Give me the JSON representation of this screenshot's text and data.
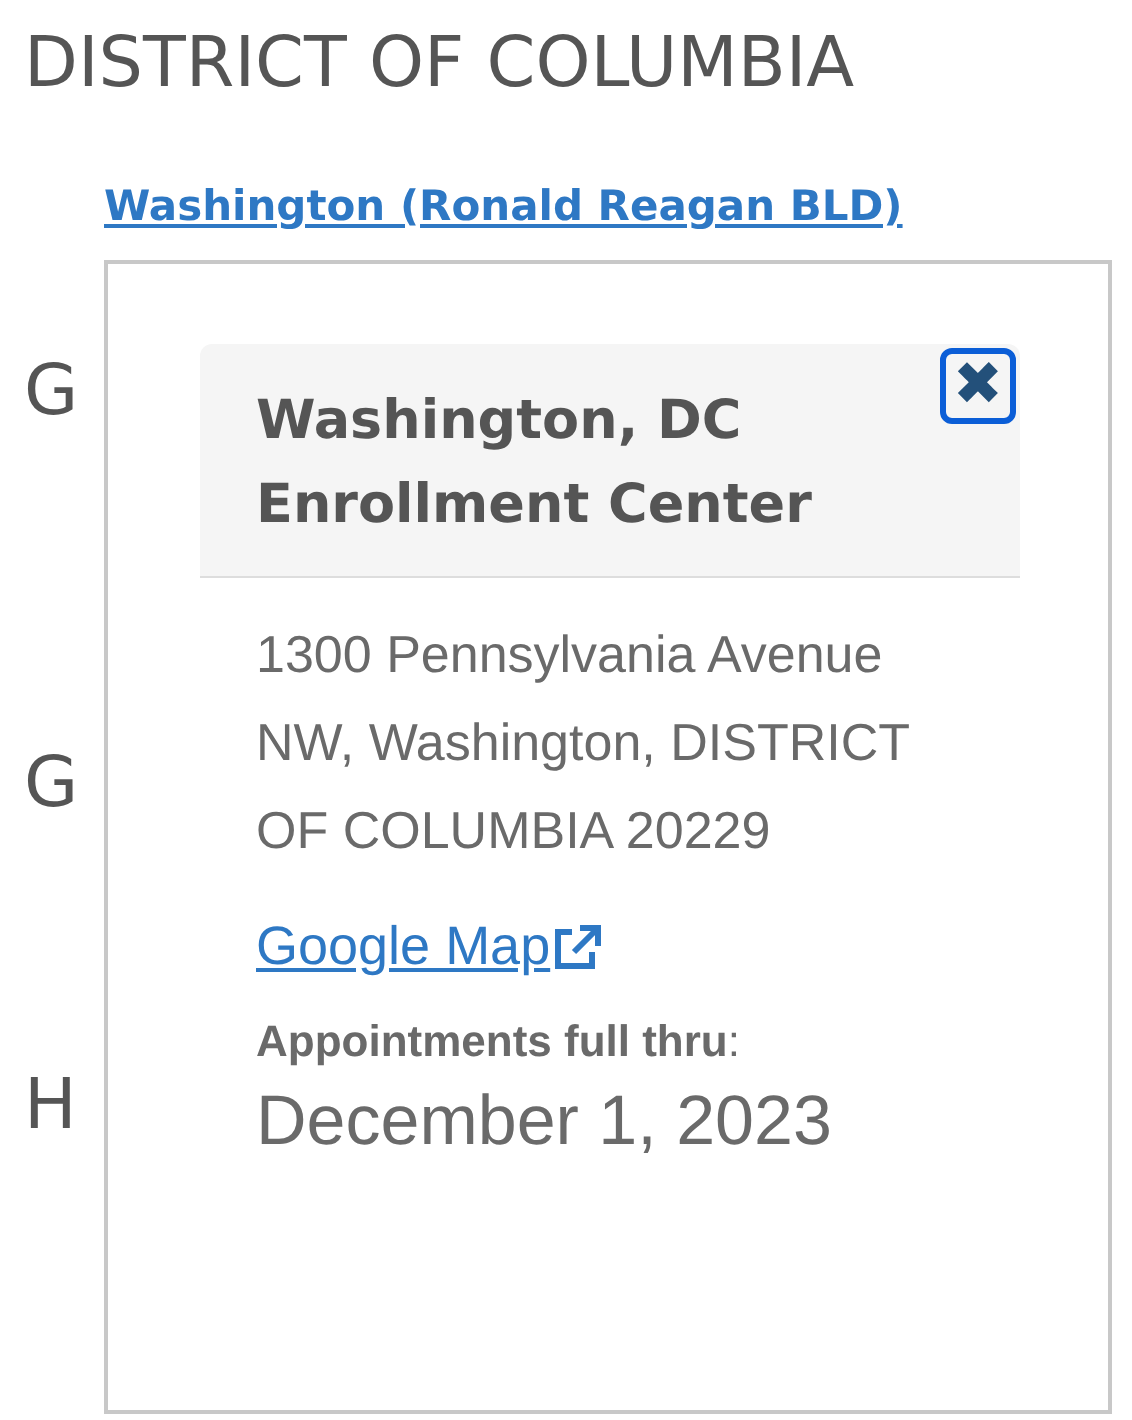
{
  "heading": "DISTRICT OF COLUMBIA",
  "location_link": "Washington (Ronald Reagan BLD)",
  "state_headings": [
    "G",
    "G",
    "H"
  ],
  "popup": {
    "title": "Washington, DC Enrollment Center",
    "close_label": "✖",
    "address": "1300 Pennsylvania Avenue NW, Washington, DISTRICT OF COLUMBIA 20229",
    "map_link": "Google Map",
    "availability_label": "Appointments full thru",
    "availability_colon": ":",
    "availability_date": "December 1, 2023"
  }
}
